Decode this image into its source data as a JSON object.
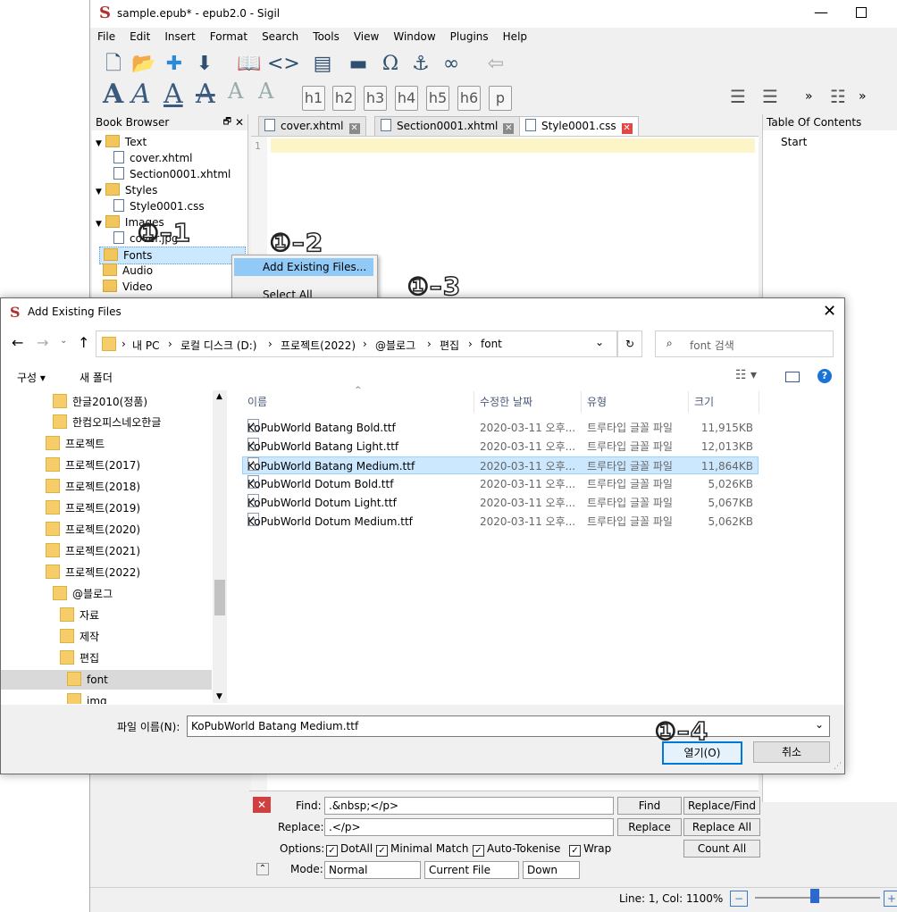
{
  "sigil": {
    "title": "sample.epub* - epub2.0 - Sigil",
    "menu": [
      "File",
      "Edit",
      "Insert",
      "Format",
      "Search",
      "Tools",
      "View",
      "Window",
      "Plugins",
      "Help"
    ],
    "heading_buttons": [
      "h1",
      "h2",
      "h3",
      "h4",
      "h5",
      "h6",
      "p"
    ],
    "book_browser": {
      "header": "Book Browser",
      "items": [
        {
          "label": "Text",
          "type": "folder"
        },
        {
          "label": "cover.xhtml",
          "type": "file"
        },
        {
          "label": "Section0001.xhtml",
          "type": "file"
        },
        {
          "label": "Styles",
          "type": "folder"
        },
        {
          "label": "Style0001.css",
          "type": "file"
        },
        {
          "label": "Images",
          "type": "folder"
        },
        {
          "label": "cover.jpg",
          "type": "file"
        },
        {
          "label": "Fonts",
          "type": "folder"
        },
        {
          "label": "Audio",
          "type": "folder"
        },
        {
          "label": "Video",
          "type": "folder"
        }
      ]
    },
    "tabs": [
      {
        "label": "cover.xhtml"
      },
      {
        "label": "Section0001.xhtml"
      },
      {
        "label": "Style0001.css"
      }
    ],
    "editor": {
      "line_number": "1"
    },
    "toc": {
      "header": "Table Of Contents",
      "items": [
        "Start"
      ]
    },
    "context_menu": {
      "items": [
        "Add Existing Files...",
        "Select All"
      ]
    },
    "find_replace": {
      "find_label": "Find:",
      "find_value": ".&nbsp;</p>",
      "replace_label": "Replace:",
      "replace_value": ".</p>",
      "options_label": "Options:",
      "options": [
        "DotAll",
        "Minimal Match",
        "Auto-Tokenise",
        "Wrap"
      ],
      "mode_label": "Mode:",
      "mode_value": "Normal",
      "scope_value": "Current File",
      "direction_value": "Down",
      "buttons": {
        "find": "Find",
        "replace_find": "Replace/Find",
        "replace": "Replace",
        "replace_all": "Replace All",
        "count_all": "Count All"
      }
    },
    "status": {
      "position": "Line: 1, Col: 1",
      "zoom": "100%"
    }
  },
  "dialog": {
    "title": "Add Existing Files",
    "breadcrumb": [
      "내 PC",
      "로컬 디스크 (D:)",
      "프로젝트(2022)",
      "@블로그",
      "편집",
      "font"
    ],
    "search_placeholder": "font 검색",
    "organize": "구성",
    "new_folder": "새 폴더",
    "nav_tree": [
      "한글2010(정품)",
      "한컴오피스네오한글",
      "프로젝트",
      "프로젝트(2017)",
      "프로젝트(2018)",
      "프로젝트(2019)",
      "프로젝트(2020)",
      "프로젝트(2021)",
      "프로젝트(2022)",
      "@블로그",
      "자료",
      "제작",
      "편집",
      "font",
      "img"
    ],
    "columns": {
      "name": "이름",
      "date": "수정한 날짜",
      "type": "유형",
      "size": "크기"
    },
    "files": [
      {
        "name": "KoPubWorld Batang Bold.ttf",
        "date": "2020-03-11 오후...",
        "type": "트루타입 글꼴 파일",
        "size": "11,915KB"
      },
      {
        "name": "KoPubWorld Batang Light.ttf",
        "date": "2020-03-11 오후...",
        "type": "트루타입 글꼴 파일",
        "size": "12,013KB"
      },
      {
        "name": "KoPubWorld Batang Medium.ttf",
        "date": "2020-03-11 오후...",
        "type": "트루타입 글꼴 파일",
        "size": "11,864KB"
      },
      {
        "name": "KoPubWorld Dotum Bold.ttf",
        "date": "2020-03-11 오후...",
        "type": "트루타입 글꼴 파일",
        "size": "5,026KB"
      },
      {
        "name": "KoPubWorld Dotum Light.ttf",
        "date": "2020-03-11 오후...",
        "type": "트루타입 글꼴 파일",
        "size": "5,067KB"
      },
      {
        "name": "KoPubWorld Dotum Medium.ttf",
        "date": "2020-03-11 오후...",
        "type": "트루타입 글꼴 파일",
        "size": "5,062KB"
      }
    ],
    "filename_label": "파일 이름(N):",
    "filename_value": "KoPubWorld Batang Medium.ttf",
    "open_button": "열기(O)",
    "cancel_button": "취소"
  },
  "annotations": [
    "①–1",
    "①–2",
    "①–3",
    "①–4"
  ],
  "colors": {
    "selection": "#cce8ff",
    "accent_blue": "#0078d7",
    "sigil_red": "#c0392b",
    "folder": "#f5cd6a"
  }
}
